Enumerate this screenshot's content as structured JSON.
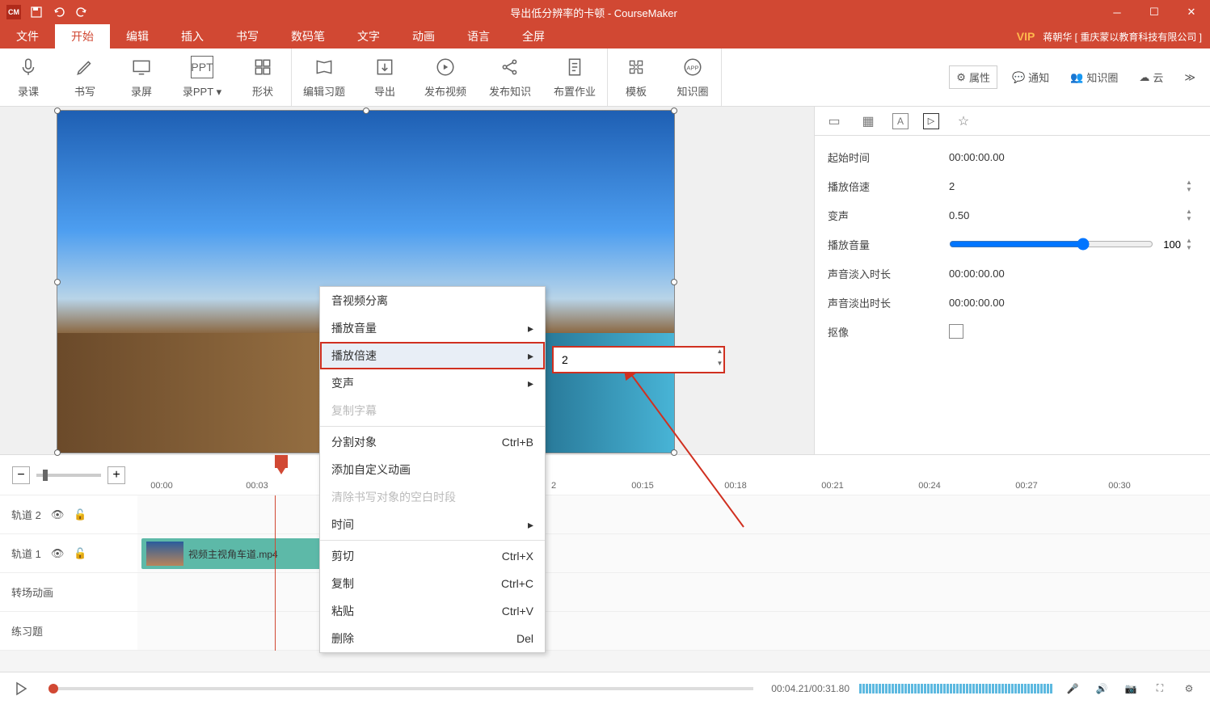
{
  "titlebar": {
    "title": "导出低分辨率的卡顿 - CourseMaker"
  },
  "menubar": {
    "tabs": [
      "文件",
      "开始",
      "编辑",
      "插入",
      "书写",
      "数码笔",
      "文字",
      "动画",
      "语言",
      "全屏"
    ],
    "active_index": 1,
    "vip": "VIP",
    "user": "蒋朝华 [ 重庆蒙以教育科技有限公司 ]"
  },
  "ribbon": {
    "buttons": [
      "录课",
      "书写",
      "录屏",
      "录PPT",
      "形状",
      "编辑习题",
      "导出",
      "发布视频",
      "发布知识",
      "布置作业",
      "模板",
      "知识圈"
    ],
    "right": {
      "attr": "属性",
      "notify": "通知",
      "circle": "知识圈",
      "cloud": "云"
    }
  },
  "context_menu": {
    "items": [
      {
        "label": "音视频分离",
        "arrow": false
      },
      {
        "label": "播放音量",
        "arrow": true
      },
      {
        "label": "播放倍速",
        "arrow": true,
        "highlight": true
      },
      {
        "label": "变声",
        "arrow": true
      },
      {
        "label": "复制字幕",
        "arrow": false,
        "disabled": true
      },
      {
        "sep": true
      },
      {
        "label": "分割对象",
        "short": "Ctrl+B"
      },
      {
        "label": "添加自定义动画"
      },
      {
        "label": "清除书写对象的空白时段",
        "disabled": true
      },
      {
        "label": "时间",
        "arrow": true
      },
      {
        "sep": true
      },
      {
        "label": "剪切",
        "short": "Ctrl+X"
      },
      {
        "label": "复制",
        "short": "Ctrl+C"
      },
      {
        "label": "粘贴",
        "short": "Ctrl+V"
      },
      {
        "label": "删除",
        "short": "Del"
      }
    ],
    "speed_value": "2"
  },
  "properties": {
    "rows": {
      "start_time": {
        "label": "起始时间",
        "value": "00:00:00.00"
      },
      "speed": {
        "label": "播放倍速",
        "value": "2"
      },
      "pitch": {
        "label": "变声",
        "value": "0.50"
      },
      "volume": {
        "label": "播放音量",
        "value": "100"
      },
      "fade_in": {
        "label": "声音淡入时长",
        "value": "00:00:00.00"
      },
      "fade_out": {
        "label": "声音淡出时长",
        "value": "00:00:00.00"
      },
      "matting": {
        "label": "抠像"
      }
    }
  },
  "timeline": {
    "ticks": [
      "00:00",
      "00:03",
      "2",
      "00:15",
      "00:18",
      "00:21",
      "00:24",
      "00:27",
      "00:30"
    ],
    "tracks": {
      "t2": "轨道 2",
      "t1": "轨道 1",
      "transition": "转场动画",
      "exercise": "练习题"
    },
    "clip_name": "视频主视角车道.mp4"
  },
  "statusbar": {
    "time": "00:04.21/00:31.80"
  }
}
